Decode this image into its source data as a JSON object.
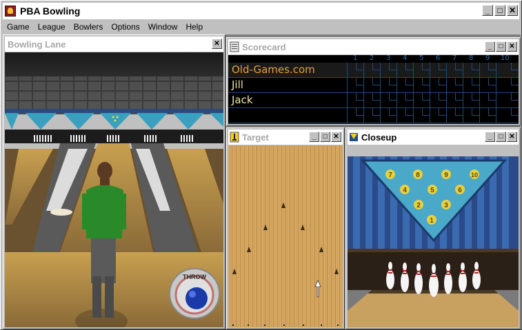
{
  "app": {
    "title": "PBA Bowling"
  },
  "window_buttons": {
    "minimize": "_",
    "maximize": "□",
    "close": "✕"
  },
  "menu": [
    "Game",
    "League",
    "Bowlers",
    "Options",
    "Window",
    "Help"
  ],
  "panels": {
    "lane": {
      "title": "Bowling Lane",
      "close": "✕",
      "throw_label": "THROW"
    },
    "scorecard": {
      "title": "Scorecard",
      "frames": [
        "1",
        "2",
        "3",
        "4",
        "5",
        "6",
        "7",
        "8",
        "9",
        "10"
      ],
      "players": [
        "Old-Games.com",
        "Jill",
        "Jack"
      ]
    },
    "target": {
      "title": "Target"
    },
    "closeup": {
      "title": "Closeup",
      "pin_numbers": [
        "7",
        "8",
        "9",
        "10",
        "4",
        "5",
        "6",
        "2",
        "3",
        "1"
      ]
    }
  }
}
